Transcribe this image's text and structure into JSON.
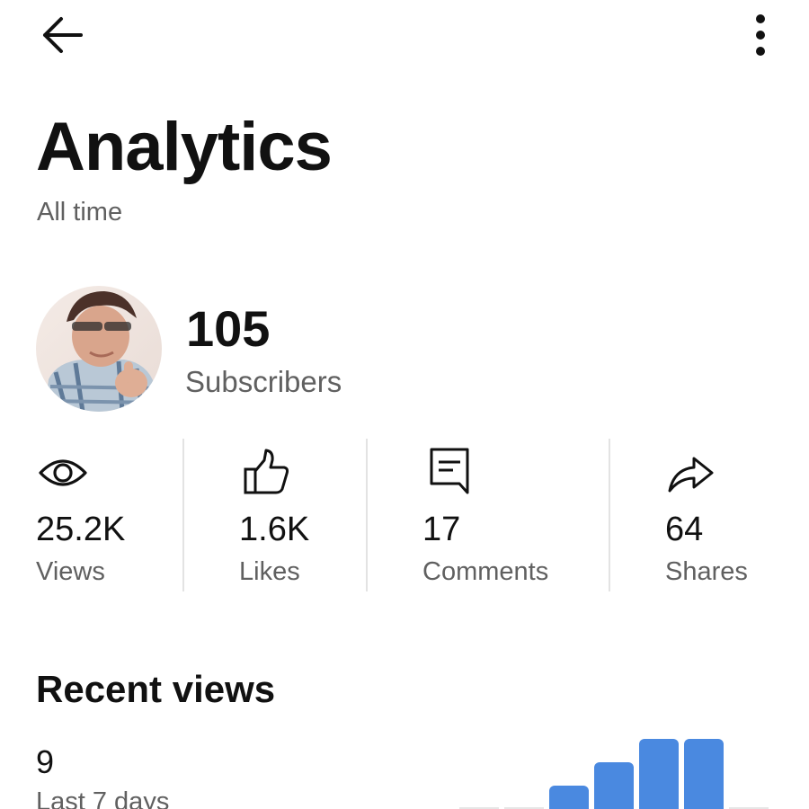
{
  "header": {
    "back_icon": "arrow-left-icon",
    "more_icon": "more-vertical-icon"
  },
  "page": {
    "title": "Analytics",
    "subtitle": "All time"
  },
  "channel": {
    "subscriber_count": "105",
    "subscriber_label": "Subscribers"
  },
  "stats": [
    {
      "icon": "eye-icon",
      "value": "25.2K",
      "label": "Views"
    },
    {
      "icon": "thumbs-up-icon",
      "value": "1.6K",
      "label": "Likes"
    },
    {
      "icon": "comment-icon",
      "value": "17",
      "label": "Comments"
    },
    {
      "icon": "share-icon",
      "value": "64",
      "label": "Shares"
    }
  ],
  "recent_views": {
    "title": "Recent views",
    "count": "9",
    "period_label": "Last 7 days"
  },
  "colors": {
    "bar": "#4a89e0",
    "baseline": "#e6e6e6",
    "text_primary": "#111111",
    "text_secondary": "#606060"
  },
  "chart_data": {
    "type": "bar",
    "categories": [
      "",
      "",
      "",
      "",
      "",
      "",
      ""
    ],
    "values": [
      0,
      0,
      1,
      2,
      3,
      3,
      0
    ],
    "title": "",
    "xlabel": "",
    "ylabel": "",
    "grid": false
  }
}
